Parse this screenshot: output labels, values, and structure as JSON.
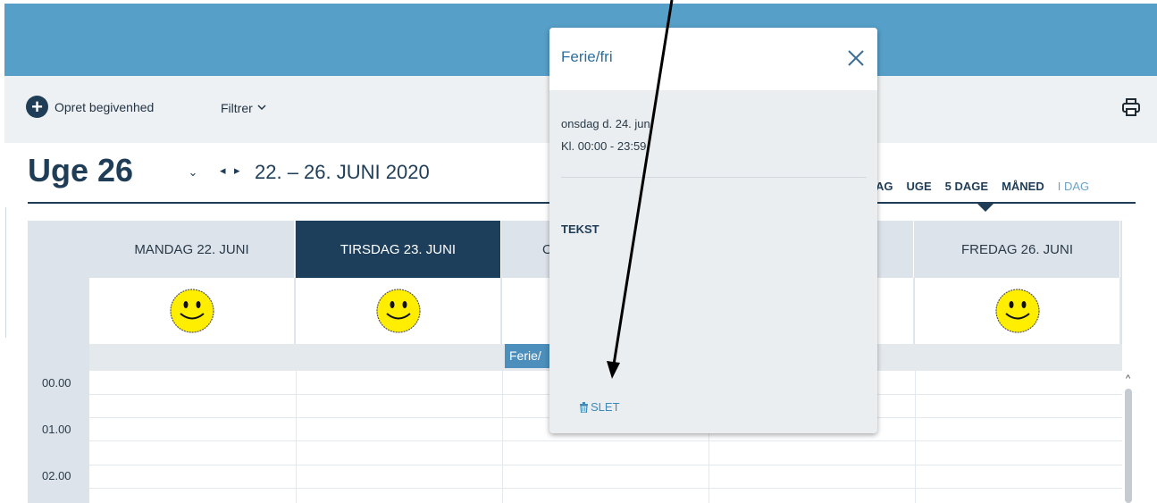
{
  "toolbar": {
    "create_label": "Opret begivenhed",
    "filter_label": "Filtrer",
    "icons": [
      "plus-circle-icon",
      "chevron-down-icon",
      "printer-icon"
    ]
  },
  "header": {
    "week_title": "Uge 26",
    "prev_symbol": "◂",
    "next_symbol": "▸",
    "dropdown_symbol": "⌄",
    "date_range": "22. – 26. JUNI 2020"
  },
  "view_tabs": {
    "partial": "AG",
    "week": "UGE",
    "five_days": "5 DAGE",
    "month": "MÅNED",
    "today": "I DAG",
    "active": "5 DAGE"
  },
  "calendar": {
    "days": [
      {
        "label": "MANDAG 22. JUNI",
        "today": false,
        "smiley": true
      },
      {
        "label": "TIRSDAG 23. JUNI",
        "today": true,
        "smiley": true
      },
      {
        "label": "O",
        "today": false,
        "smiley": false
      },
      {
        "label": "",
        "today": false,
        "smiley": false
      },
      {
        "label": "FREDAG 26. JUNI",
        "today": false,
        "smiley": true
      }
    ],
    "event_label": "Ferie/",
    "times": [
      "00.00",
      "01.00",
      "02.00"
    ]
  },
  "popup": {
    "title": "Ferie/fri",
    "date": "onsdag d. 24. jun.",
    "time": "Kl. 00:00 - 23:59",
    "text_label": "TEKST",
    "delete_label": "SLET"
  },
  "colors": {
    "topbar": "#559fc8",
    "navy": "#1f3d57",
    "today_header": "#1d3f5c",
    "event": "#4c8fbc",
    "smiley": "#ffee00"
  }
}
